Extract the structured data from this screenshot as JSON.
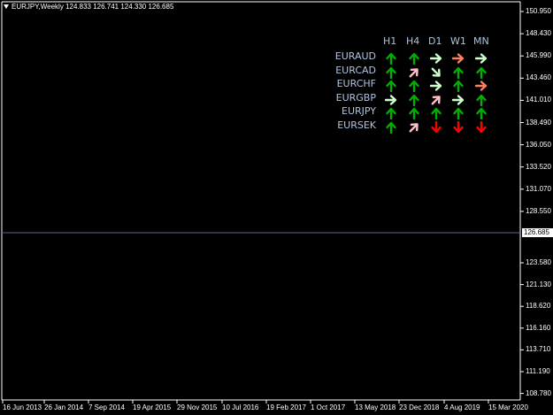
{
  "header": {
    "title": "EURJPY,Weekly  124.833 126.741 124.330 126.685"
  },
  "price_axis": {
    "labels": [
      "150.950",
      "148.430",
      "145.990",
      "143.460",
      "141.010",
      "138.490",
      "136.050",
      "133.520",
      "131.070",
      "128.550",
      "126.685",
      "123.580",
      "121.130",
      "118.620",
      "116.160",
      "113.710",
      "111.190",
      "108.780"
    ],
    "current": "126.685"
  },
  "time_axis": {
    "labels": [
      "16 Jun 2013",
      "26 Jan 2014",
      "7 Sep 2014",
      "19 Apr 2015",
      "29 Nov 2015",
      "10 Jul 2016",
      "19 Feb 2017",
      "1 Oct 2017",
      "13 May 2018",
      "23 Dec 2018",
      "4 Aug 2019",
      "15 Mar 2020"
    ]
  },
  "colors": {
    "background": "#000000",
    "axis": "#ffffff",
    "price_line": "#5a6a8a",
    "label_text": "#b0c4de",
    "up": "#00b000",
    "down": "#ff0000",
    "flat": "#ccffcc",
    "diag_up": "#ffc0cb",
    "diag_down": "#ccffcc",
    "flat_salmon": "#ff8060"
  },
  "panel": {
    "timeframes": [
      "H1",
      "H4",
      "D1",
      "W1",
      "MN"
    ],
    "rows": [
      {
        "symbol": "EURAUD",
        "arrows": [
          "up-green",
          "up-green",
          "right-light",
          "right-salmon",
          "right-light"
        ]
      },
      {
        "symbol": "EURCAD",
        "arrows": [
          "up-green",
          "upright-pink",
          "downright-light",
          "up-green",
          "up-green"
        ]
      },
      {
        "symbol": "EURCHF",
        "arrows": [
          "up-green",
          "up-green",
          "right-light",
          "up-green",
          "right-salmon"
        ]
      },
      {
        "symbol": "EURGBP",
        "arrows": [
          "right-light",
          "up-green",
          "upright-pink",
          "right-light",
          "up-green"
        ]
      },
      {
        "symbol": "EURJPY",
        "arrows": [
          "up-green",
          "up-green",
          "up-green",
          "up-green",
          "up-green"
        ]
      },
      {
        "symbol": "EURSEK",
        "arrows": [
          "up-green",
          "upright-pink",
          "down-red",
          "down-red",
          "down-red"
        ]
      }
    ]
  }
}
